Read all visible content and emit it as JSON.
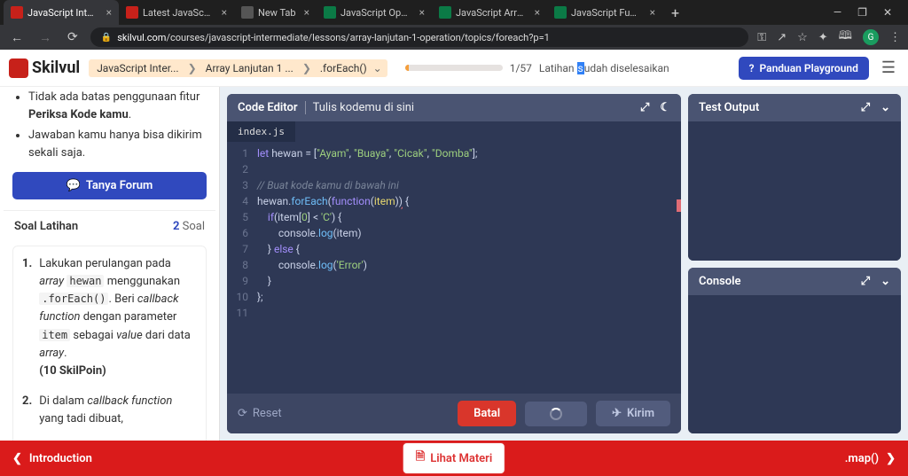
{
  "browser": {
    "tabs": [
      {
        "label": "JavaScript Interme",
        "active": true,
        "favicon": "#c7211a"
      },
      {
        "label": "Latest JavaScript I",
        "favicon": "#c7211a"
      },
      {
        "label": "New Tab",
        "favicon": "#555"
      },
      {
        "label": "JavaScript Operato",
        "favicon": "#0b7a46"
      },
      {
        "label": "JavaScript Array fil",
        "favicon": "#0b7a46"
      },
      {
        "label": "JavaScript Function",
        "favicon": "#0b7a46"
      }
    ],
    "url_host": "skilvul.com",
    "url_path": "/courses/javascript-intermediate/lessons/array-lanjutan-1-operation/topics/foreach?p=1",
    "profile_letter": "G"
  },
  "topbar": {
    "logo": "Skilvul",
    "crumbs": [
      "JavaScript Inter...",
      "Array Lanjutan 1 ...",
      ".forEach()"
    ],
    "progress": "1/57",
    "latihan_pre": "Latihan ",
    "latihan_hl": "s",
    "latihan_post": "udah diselesaikan",
    "guide_btn": "Panduan Playground"
  },
  "sidebar": {
    "rules": [
      "Tidak ada batas penggunaan fitur <b>Periksa Kode kamu</b>.",
      "Jawaban kamu hanya bisa dikirim sekali saja."
    ],
    "forum_btn": "Tanya Forum",
    "section_title": "Soal Latihan",
    "section_count": "2",
    "section_count_label": " Soal",
    "exercises": [
      {
        "num": "1.",
        "html": "Lakukan perulangan pada <em>array</em> <code>hewan</code> menggunakan <code>.forEach()</code>. Beri <em>callback function</em> dengan parameter <code>item</code> sebagai <em>value</em> dari data <em>array</em>.<br><b>(10 SkilPoin)</b>"
      },
      {
        "num": "2.",
        "html": "Di dalam <em>callback function</em> yang tadi dibuat,"
      }
    ]
  },
  "editor": {
    "title": "Code Editor",
    "subtitle": "Tulis kodemu di sini",
    "file": "index.js",
    "lines": [
      {
        "n": 1,
        "html": "<span class='kw'>let</span> hewan = [<span class='str'>\"Ayam\"</span>, <span class='str'>\"Buaya\"</span>, <span class='str'>\"Cicak\"</span>, <span class='str'>\"Domba\"</span>];"
      },
      {
        "n": 2,
        "html": ""
      },
      {
        "n": 3,
        "html": "<span class='cm'>// Buat kode kamu di bawah ini</span>"
      },
      {
        "n": 4,
        "html": "hewan.<span class='fn'>forEach</span>(<span class='kw'>function</span>(<span class='pr'>item</span>)<span class='er'>)</span> {"
      },
      {
        "n": 5,
        "html": "    <span class='kw'>if</span>(item[<span class='str'>0</span>] &lt; <span class='str'>'C'</span>) {"
      },
      {
        "n": 6,
        "html": "        console.<span class='fn'>log</span>(item)"
      },
      {
        "n": 7,
        "html": "    } <span class='kw'>else</span> {"
      },
      {
        "n": 8,
        "html": "        console.<span class='fn'>log</span>(<span class='str'>'Error'</span>)"
      },
      {
        "n": 9,
        "html": "    }"
      },
      {
        "n": 10,
        "html": "};"
      },
      {
        "n": 11,
        "html": ""
      }
    ],
    "reset": "Reset",
    "batal": "Batal",
    "kirim": "Kirim"
  },
  "output": {
    "test_title": "Test Output",
    "console_title": "Console"
  },
  "bottom": {
    "prev": "Introduction",
    "materi": "Lihat Materi",
    "next": ".map()"
  }
}
